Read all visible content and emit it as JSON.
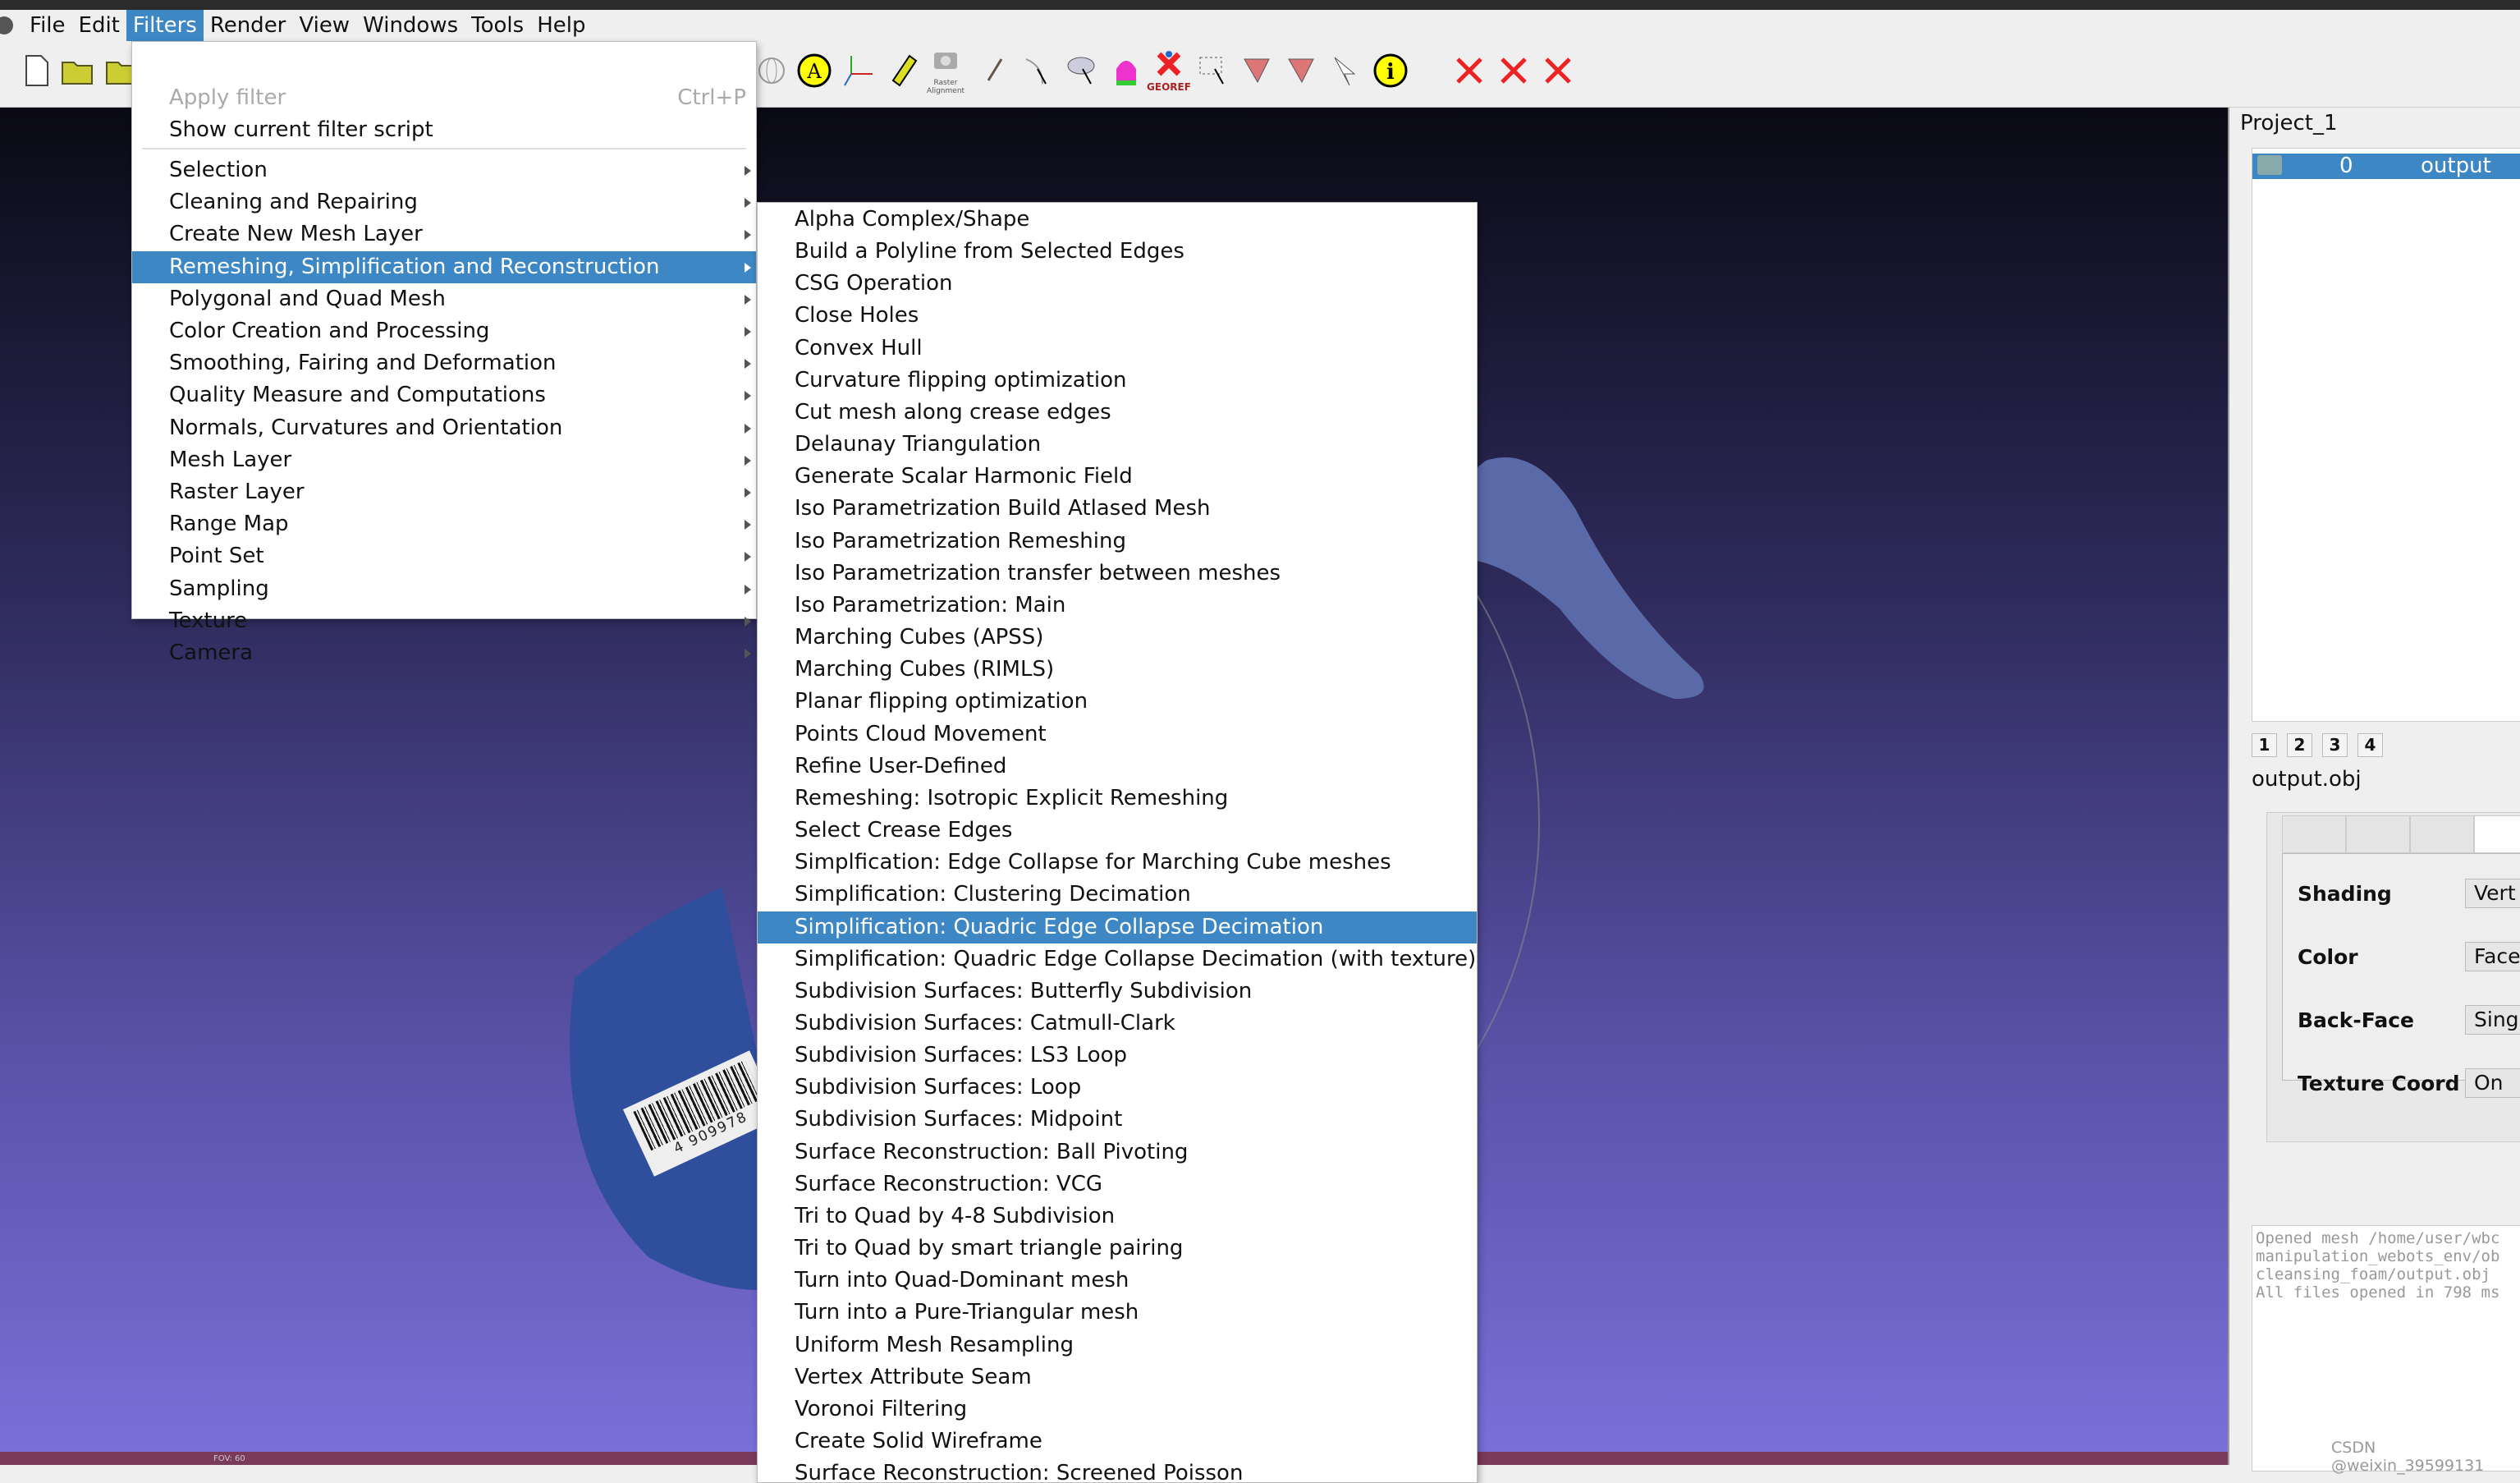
{
  "menubar": [
    "File",
    "Edit",
    "Filters",
    "Render",
    "View",
    "Windows",
    "Tools",
    "Help"
  ],
  "filters_menu": {
    "apply": "Apply filter",
    "apply_shortcut": "Ctrl+P",
    "show_script": "Show current filter script",
    "items": [
      "Selection",
      "Cleaning and Repairing",
      "Create New Mesh Layer",
      "Remeshing, Simplification and Reconstruction",
      "Polygonal and Quad Mesh",
      "Color Creation and Processing",
      "Smoothing, Fairing and Deformation",
      "Quality Measure and Computations",
      "Normals, Curvatures and Orientation",
      "Mesh Layer",
      "Raster Layer",
      "Range Map",
      "Point Set",
      "Sampling",
      "Texture",
      "Camera"
    ],
    "highlighted": "Remeshing, Simplification and Reconstruction"
  },
  "submenu": {
    "items": [
      "Alpha Complex/Shape",
      "Build a Polyline from Selected Edges",
      "CSG Operation",
      "Close Holes",
      "Convex Hull",
      "Curvature flipping optimization",
      "Cut mesh along crease edges",
      "Delaunay Triangulation",
      "Generate Scalar Harmonic Field",
      "Iso Parametrization Build Atlased Mesh",
      "Iso Parametrization Remeshing",
      "Iso Parametrization transfer between meshes",
      "Iso Parametrization: Main",
      "Marching Cubes (APSS)",
      "Marching Cubes (RIMLS)",
      "Planar flipping optimization",
      "Points Cloud Movement",
      "Refine User-Defined",
      "Remeshing: Isotropic Explicit Remeshing",
      "Select Crease Edges",
      "Simplfication: Edge Collapse for Marching Cube meshes",
      "Simplification: Clustering Decimation",
      "Simplification: Quadric Edge Collapse Decimation",
      "Simplification: Quadric Edge Collapse Decimation (with texture)",
      "Subdivision Surfaces: Butterfly Subdivision",
      "Subdivision Surfaces: Catmull-Clark",
      "Subdivision Surfaces: LS3 Loop",
      "Subdivision Surfaces: Loop",
      "Subdivision Surfaces: Midpoint",
      "Surface Reconstruction: Ball Pivoting",
      "Surface Reconstruction: VCG",
      "Tri to Quad by 4-8 Subdivision",
      "Tri to Quad by smart triangle pairing",
      "Turn into Quad-Dominant mesh",
      "Turn into a Pure-Triangular mesh",
      "Uniform Mesh Resampling",
      "Vertex Attribute Seam",
      "Voronoi Filtering",
      "Create Solid Wireframe",
      "Surface Reconstruction: Screened Poisson"
    ],
    "highlighted_index": 22
  },
  "toolbar": {
    "georef": "GEOREF",
    "raster": "Raster Alignment"
  },
  "viewport": {
    "fov": "FOV: 60",
    "barcode": "4 909978"
  },
  "panel": {
    "project": "Project_1",
    "layer": {
      "id": "0",
      "name": "output"
    },
    "view_buttons": [
      "1",
      "2",
      "3",
      "4"
    ],
    "mesh_name": "output.obj",
    "props": [
      {
        "label": "Shading",
        "value": "Vert"
      },
      {
        "label": "Color",
        "value": "Face"
      },
      {
        "label": "Back-Face",
        "value": "Singl"
      },
      {
        "label": "Texture Coord",
        "value": "On"
      }
    ],
    "log": "Opened mesh /home/user/wbc\nmanipulation_webots_env/ob\ncleansing_foam/output.obj \nAll files opened in 798 ms"
  },
  "watermark": "CSDN @weixin_39599131",
  "colors": {
    "accent": "#3c87c4"
  }
}
